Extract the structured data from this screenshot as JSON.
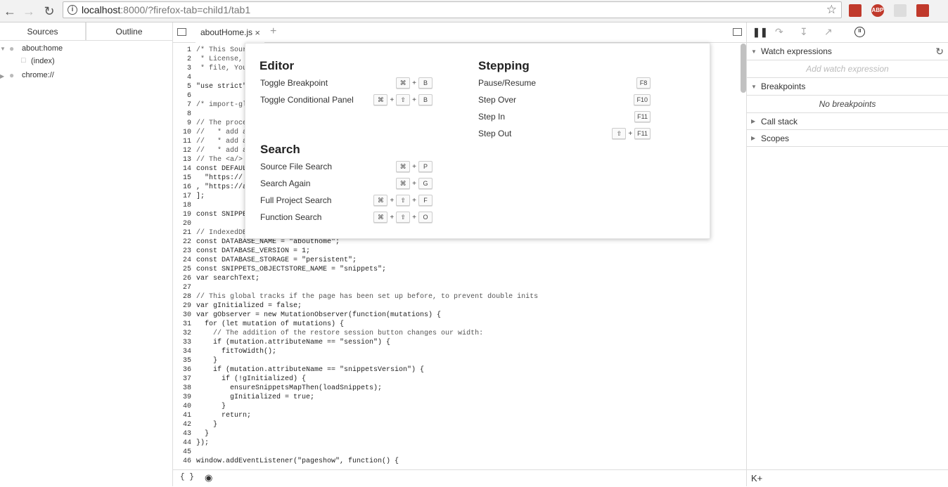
{
  "browser": {
    "url_host": "localhost",
    "url_rest": ":8000/?firefox-tab=child1/tab1",
    "ext_abp": "ABP"
  },
  "sources": {
    "tabs": [
      "Sources",
      "Outline"
    ],
    "tree": [
      {
        "label": "about:home"
      },
      {
        "label": "(index)"
      },
      {
        "label": "chrome://"
      }
    ]
  },
  "editor": {
    "file_tab": "aboutHome.js",
    "lines": [
      {
        "n": "1",
        "t": "/* This Sour"
      },
      {
        "n": "2",
        "t": " * License,"
      },
      {
        "n": "3",
        "t": " * file, You"
      },
      {
        "n": "4",
        "t": ""
      },
      {
        "n": "5",
        "t": "\"use strict\""
      },
      {
        "n": "6",
        "t": ""
      },
      {
        "n": "7",
        "t": "/* import-gl"
      },
      {
        "n": "8",
        "t": ""
      },
      {
        "n": "9",
        "t": "// The proce"
      },
      {
        "n": "10",
        "t": "//   * add a"
      },
      {
        "n": "11",
        "t": "//   * add a"
      },
      {
        "n": "12",
        "t": "//   * add a"
      },
      {
        "n": "13",
        "t": "// The <a/>"
      },
      {
        "n": "14",
        "t": "const DEFAUL"
      },
      {
        "n": "15",
        "t": "  \"https://"
      },
      {
        "n": "16",
        "t": ", \"https://a"
      },
      {
        "n": "17",
        "t": "];"
      },
      {
        "n": "18",
        "t": ""
      },
      {
        "n": "19",
        "t": "const SNIPPE"
      },
      {
        "n": "20",
        "t": ""
      },
      {
        "n": "21",
        "t": "// IndexedDB"
      },
      {
        "n": "22",
        "t": "const DATABASE_NAME = \"abouthome\";"
      },
      {
        "n": "23",
        "t": "const DATABASE_VERSION = 1;"
      },
      {
        "n": "24",
        "t": "const DATABASE_STORAGE = \"persistent\";"
      },
      {
        "n": "25",
        "t": "const SNIPPETS_OBJECTSTORE_NAME = \"snippets\";"
      },
      {
        "n": "26",
        "t": "var searchText;"
      },
      {
        "n": "27",
        "t": ""
      },
      {
        "n": "28",
        "t": "// This global tracks if the page has been set up before, to prevent double inits"
      },
      {
        "n": "29",
        "t": "var gInitialized = false;"
      },
      {
        "n": "30",
        "t": "var gObserver = new MutationObserver(function(mutations) {"
      },
      {
        "n": "31",
        "t": "  for (let mutation of mutations) {"
      },
      {
        "n": "32",
        "t": "    // The addition of the restore session button changes our width:"
      },
      {
        "n": "33",
        "t": "    if (mutation.attributeName == \"session\") {"
      },
      {
        "n": "34",
        "t": "      fitToWidth();"
      },
      {
        "n": "35",
        "t": "    }"
      },
      {
        "n": "36",
        "t": "    if (mutation.attributeName == \"snippetsVersion\") {"
      },
      {
        "n": "37",
        "t": "      if (!gInitialized) {"
      },
      {
        "n": "38",
        "t": "        ensureSnippetsMapThen(loadSnippets);"
      },
      {
        "n": "39",
        "t": "        gInitialized = true;"
      },
      {
        "n": "40",
        "t": "      }"
      },
      {
        "n": "41",
        "t": "      return;"
      },
      {
        "n": "42",
        "t": "    }"
      },
      {
        "n": "43",
        "t": "  }"
      },
      {
        "n": "44",
        "t": "});"
      },
      {
        "n": "45",
        "t": ""
      },
      {
        "n": "46",
        "t": "window.addEventListener(\"pageshow\", function() {"
      }
    ],
    "footer_braces": "{ }"
  },
  "shortcuts": {
    "editor_title": "Editor",
    "stepping_title": "Stepping",
    "search_title": "Search",
    "editor": [
      {
        "label": "Toggle Breakpoint",
        "keys": [
          "⌘",
          "B"
        ]
      },
      {
        "label": "Toggle Conditional Panel",
        "keys": [
          "⌘",
          "⇧",
          "B"
        ]
      }
    ],
    "stepping": [
      {
        "label": "Pause/Resume",
        "keys": [
          "F8"
        ]
      },
      {
        "label": "Step Over",
        "keys": [
          "F10"
        ]
      },
      {
        "label": "Step In",
        "keys": [
          "F11"
        ]
      },
      {
        "label": "Step Out",
        "keys": [
          "⇧",
          "F11"
        ]
      }
    ],
    "search": [
      {
        "label": "Source File Search",
        "keys": [
          "⌘",
          "P"
        ]
      },
      {
        "label": "Search Again",
        "keys": [
          "⌘",
          "G"
        ]
      },
      {
        "label": "Full Project Search",
        "keys": [
          "⌘",
          "⇧",
          "F"
        ]
      },
      {
        "label": "Function Search",
        "keys": [
          "⌘",
          "⇧",
          "O"
        ]
      }
    ],
    "plus": "+"
  },
  "right": {
    "watch": "Watch expressions",
    "watch_placeholder": "Add watch expression",
    "breakpoints": "Breakpoints",
    "no_breakpoints": "No breakpoints",
    "callstack": "Call stack",
    "scopes": "Scopes",
    "footer": "K+"
  }
}
